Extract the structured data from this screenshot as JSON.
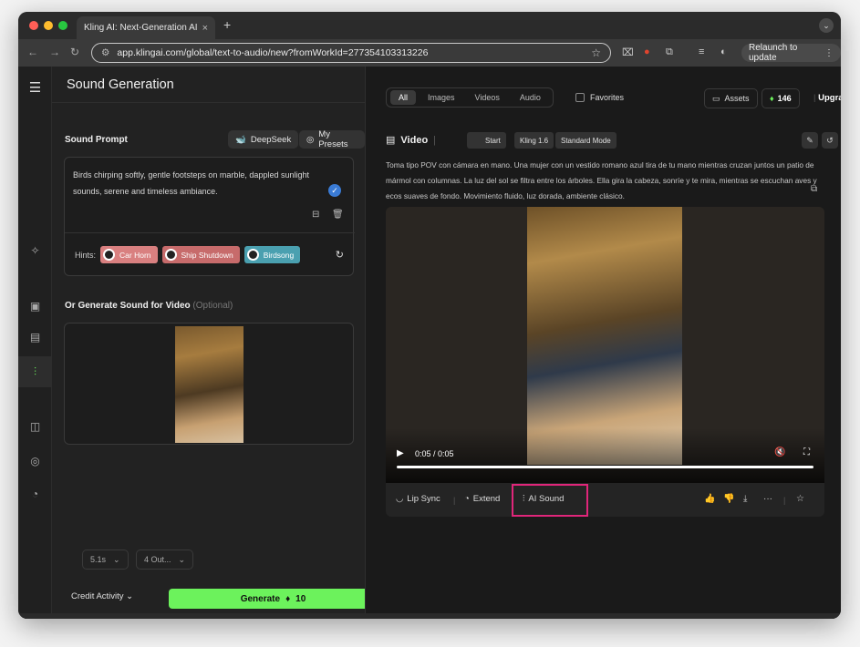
{
  "browser": {
    "tab_title": "Kling AI: Next-Generation AI C",
    "tab_favicon": "K",
    "url": "app.klingai.com/global/text-to-audio/new?fromWorkId=277354103313226",
    "relaunch_label": "Relaunch to update"
  },
  "left_panel": {
    "title": "Sound Generation",
    "prompt_label": "Sound Prompt",
    "deepseek_label": "DeepSeek",
    "presets_label": "My Presets",
    "prompt_text": "Birds chirping softly, gentle footsteps on marble, dappled sunlight sounds, serene and timeless ambiance.",
    "hints_label": "Hints:",
    "hints": [
      {
        "label": "Car Horn",
        "color": "#d98080"
      },
      {
        "label": "Ship Shutdown",
        "color": "#c76b6b"
      },
      {
        "label": "Birdsong",
        "color": "#4aa0b0"
      }
    ],
    "video_label": "Or Generate Sound for Video",
    "video_optional": "(Optional)",
    "duration_value": "5.1s",
    "outputs_value": "4 Out...",
    "credit_activity": "Credit Activity",
    "generate_label": "Generate",
    "generate_cost": "10"
  },
  "right_panel": {
    "filters": [
      "All",
      "Images",
      "Videos",
      "Audio"
    ],
    "favorites_label": "Favorites",
    "assets_label": "Assets",
    "credits_value": "146",
    "upgrade_label": "Upgra",
    "video_title": "Video",
    "tags": [
      "Start",
      "Kling 1.6",
      "Standard Mode"
    ],
    "description": "Toma tipo POV con cámara en mano. Una mujer con un vestido romano azul tira de tu mano mientras cruzan juntos un patio de mármol con columnas. La luz del sol se filtra entre los árboles. Ella gira la cabeza, sonríe y te mira, mientras se escuchan aves y ecos suaves de fondo. Movimiento fluido, luz dorada, ambiente clásico.",
    "time_display": "0:05 / 0:05",
    "progress": 1.0,
    "actions": {
      "lip_sync": "Lip Sync",
      "extend": "Extend",
      "ai_sound": "AI Sound"
    }
  },
  "colors": {
    "accent_green": "#6cf25c",
    "highlight_pink": "#e0267a",
    "check_blue": "#3a7bd5"
  }
}
